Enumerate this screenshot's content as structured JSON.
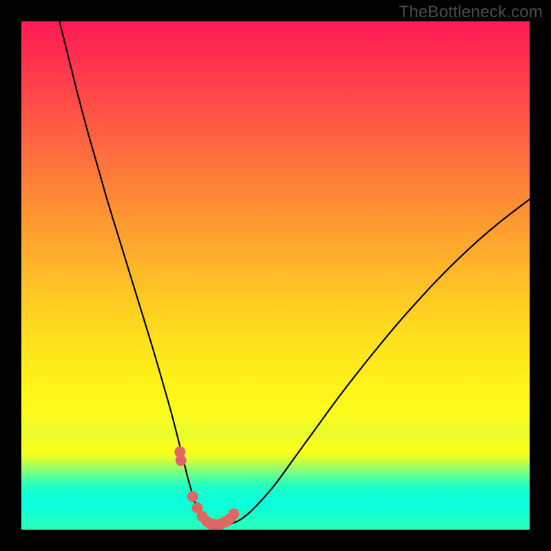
{
  "watermark": "TheBottleneck.com",
  "chart_data": {
    "type": "line",
    "title": "",
    "xlabel": "",
    "ylabel": "",
    "xlim": [
      0,
      100
    ],
    "ylim": [
      0,
      100
    ],
    "series": [
      {
        "name": "bottleneck-curve",
        "x": [
          7.5,
          9,
          11,
          13,
          15,
          17,
          19,
          21,
          23,
          25,
          26.5,
          28,
          29.5,
          30.8,
          31.8,
          32.8,
          33.8,
          34.6,
          35.4,
          36.3,
          37.3,
          38.4,
          39.6,
          41,
          42.8,
          44.7,
          47,
          50,
          54,
          58,
          62,
          66,
          70,
          74,
          78,
          82,
          86,
          90,
          94,
          98,
          100
        ],
        "y": [
          100,
          94,
          86,
          78.5,
          71.5,
          64.5,
          58,
          51.5,
          45,
          38.5,
          33.5,
          28.3,
          23,
          18,
          14,
          10,
          6.5,
          4,
          2.3,
          1.3,
          0.9,
          0.85,
          0.9,
          1.1,
          1.8,
          3.2,
          5.5,
          9,
          14.5,
          20,
          25.5,
          30.7,
          35.7,
          40.5,
          45,
          49.3,
          53.3,
          57,
          60.4,
          63.5,
          65
        ]
      },
      {
        "name": "highlight-dots",
        "x": [
          31.2,
          31.4,
          33.7,
          34.6,
          35.6,
          36.5,
          37.3,
          38.2,
          39.2,
          40.0,
          40.3,
          41.1,
          41.8
        ],
        "y": [
          15.3,
          13.6,
          6.5,
          4.3,
          2.6,
          1.6,
          1.1,
          1.0,
          1.1,
          1.5,
          1.6,
          2.2,
          3.1
        ]
      }
    ],
    "colors": {
      "curve": "#000000",
      "dots": "#e06664",
      "gradient_top": "#ff1a54",
      "gradient_mid": "#fff219",
      "gradient_bottom": "#25ffbf"
    }
  }
}
